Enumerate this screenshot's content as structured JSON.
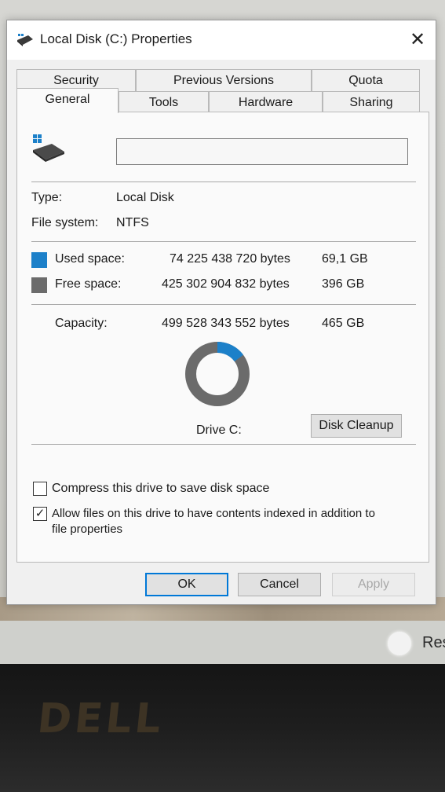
{
  "window": {
    "title": "Local Disk (C:) Properties",
    "close_glyph": "✕"
  },
  "tabs": {
    "row1": [
      "Security",
      "Previous Versions",
      "Quota"
    ],
    "row2": [
      "General",
      "Tools",
      "Hardware",
      "Sharing"
    ],
    "active": "General"
  },
  "general": {
    "drive_name_value": "",
    "type_label": "Type:",
    "type_value": "Local Disk",
    "fs_label": "File system:",
    "fs_value": "NTFS",
    "used_label": "Used space:",
    "used_bytes": "74 225 438 720 bytes",
    "used_gb": "69,1 GB",
    "free_label": "Free space:",
    "free_bytes": "425 302 904 832 bytes",
    "free_gb": "396 GB",
    "capacity_label": "Capacity:",
    "capacity_bytes": "499 528 343 552 bytes",
    "capacity_gb": "465 GB",
    "drive_label": "Drive C:",
    "used_fraction": 0.1486,
    "disk_cleanup_label": "Disk Cleanup",
    "compress_label": "Compress this drive to save disk space",
    "compress_checked": false,
    "index_label_line1": "Allow files on this drive to have contents indexed in addition to",
    "index_label_line2": "file properties",
    "index_checked": true
  },
  "buttons": {
    "ok": "OK",
    "cancel": "Cancel",
    "apply": "Apply"
  },
  "colors": {
    "used": "#1c80c9",
    "free": "#6b6b6b",
    "accent": "#0078d7"
  },
  "taskbar": {
    "tray_text": "Res"
  },
  "bezel": {
    "brand": "DELL"
  }
}
